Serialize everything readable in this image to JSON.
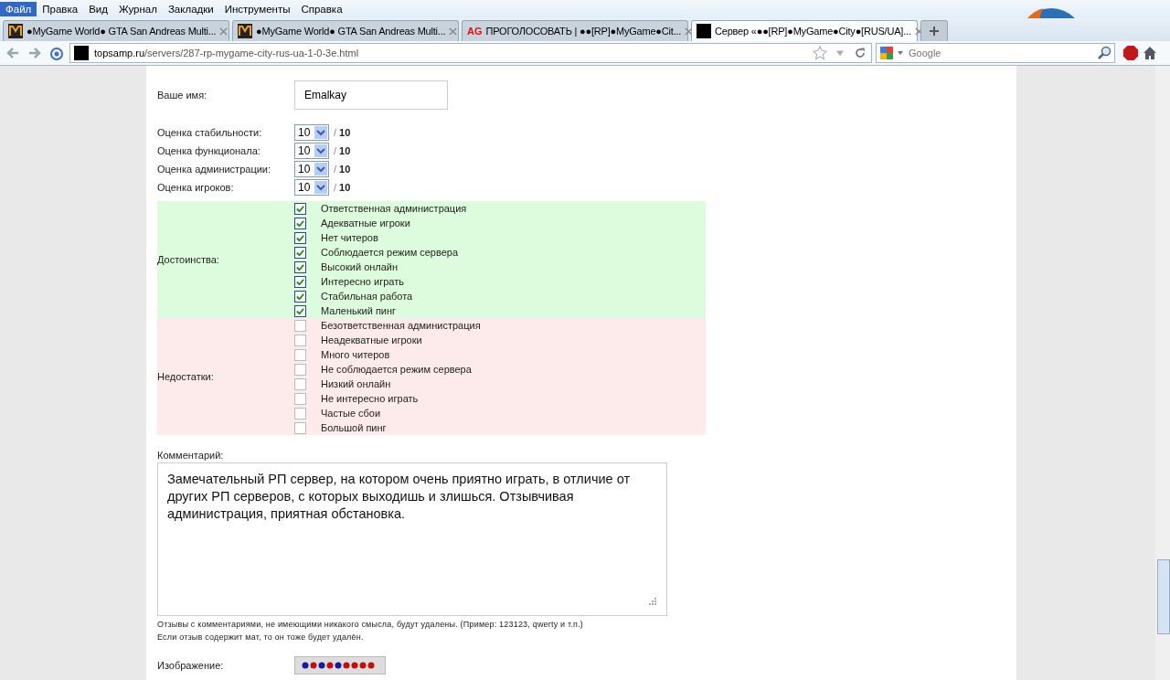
{
  "menu": [
    {
      "label": "Файл",
      "selected": true
    },
    {
      "label": "Правка",
      "selected": false
    },
    {
      "label": "Вид",
      "selected": false
    },
    {
      "label": "Журнал",
      "selected": false
    },
    {
      "label": "Закладки",
      "selected": false
    },
    {
      "label": "Инструменты",
      "selected": false
    },
    {
      "label": "Справка",
      "selected": false
    }
  ],
  "tabs": [
    {
      "kind": "mg",
      "title": "●MyGame World● GTA San Andreas Multi...",
      "selected": false
    },
    {
      "kind": "mg",
      "title": "●MyGame World● GTA San Andreas Multi...",
      "selected": false
    },
    {
      "kind": "ag",
      "icon_text": "AG",
      "title": "ПРОГОЛОСОВАТЬ | ●●[RP]●MyGame●Cit...",
      "selected": false
    },
    {
      "kind": "black",
      "title": "Сервер «●●[RP]●MyGame●City●[RUS/UA]...",
      "selected": true
    }
  ],
  "address": {
    "host": "topsamp.ru",
    "path": "/servers/287-rp-mygame-city-rus-ua-1-0-3e.html"
  },
  "search": {
    "placeholder": "Google"
  },
  "form": {
    "name_label": "Ваше имя:",
    "name_value": "Emalkay",
    "ratings": [
      {
        "label": "Оценка стабильности:",
        "value": "10",
        "separator": "/",
        "max": "10"
      },
      {
        "label": "Оценка функционала:",
        "value": "10",
        "separator": "/",
        "max": "10"
      },
      {
        "label": "Оценка администрации:",
        "value": "10",
        "separator": "/",
        "max": "10"
      },
      {
        "label": "Оценка игроков:",
        "value": "10",
        "separator": "/",
        "max": "10"
      }
    ],
    "groups": [
      {
        "kind": "pros",
        "label": "Достоинства:",
        "items": [
          {
            "label": "Ответственная администрация",
            "checked": true
          },
          {
            "label": "Адекватные игроки",
            "checked": true
          },
          {
            "label": "Нет читеров",
            "checked": true
          },
          {
            "label": "Соблюдается режим сервера",
            "checked": true
          },
          {
            "label": "Высокий онлайн",
            "checked": true
          },
          {
            "label": "Интересно играть",
            "checked": true
          },
          {
            "label": "Стабильная работа",
            "checked": true
          },
          {
            "label": "Маленький пинг",
            "checked": true
          }
        ]
      },
      {
        "kind": "cons",
        "label": "Недостатки:",
        "items": [
          {
            "label": "Безответственная администрация",
            "checked": false
          },
          {
            "label": "Неадекватные игроки",
            "checked": false
          },
          {
            "label": "Много читеров",
            "checked": false
          },
          {
            "label": "Не соблюдается режим сервера",
            "checked": false
          },
          {
            "label": "Низкий онлайн",
            "checked": false
          },
          {
            "label": "Не интересно играть",
            "checked": false
          },
          {
            "label": "Частые сбои",
            "checked": false
          },
          {
            "label": "Большой пинг",
            "checked": false
          }
        ]
      }
    ],
    "comment_label": "Комментарий:",
    "comment": "Замечательный РП сервер, на котором очень приятно играть, в отличие от других РП серверов, с которых выходишь и злишься. Отзывчивая администрация, приятная обстановка.",
    "notes": [
      "Отзывы с комментариями, не имеющими никакого смысла, будут удалены. (Пример: 123123, qwerty и т.п.)",
      "Если отзыв содержит мат, то он тоже будет удалён."
    ],
    "image_label": "Изображение:"
  }
}
